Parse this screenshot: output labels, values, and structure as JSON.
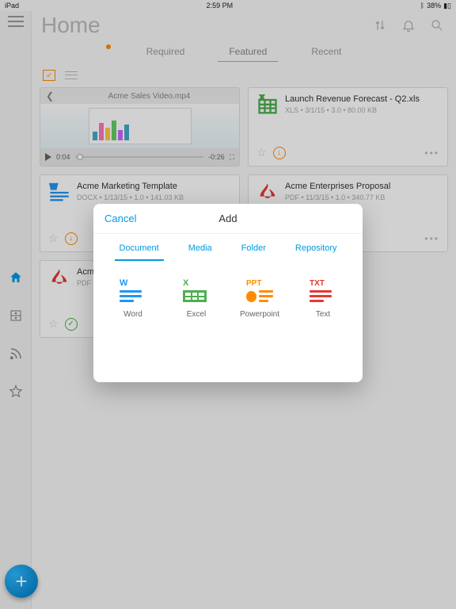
{
  "statusbar": {
    "device": "iPad",
    "time": "2:59 PM",
    "battery": "38%"
  },
  "header": {
    "title": "Home"
  },
  "tabs": {
    "required": "Required",
    "featured": "Featured",
    "recent": "Recent"
  },
  "video": {
    "title": "Acme Sales Video.mp4",
    "elapsed": "0:04",
    "remaining": "-0:26"
  },
  "cards": {
    "launch": {
      "title": "Launch Revenue Forecast - Q2.xls",
      "meta": "XLS  •  3/1/15  •  3.0  •  80.00 KB"
    },
    "marketing": {
      "title": "Acme Marketing Template",
      "meta": "DOCX  •  1/13/15  •  1.0  •  141.03 KB"
    },
    "proposal": {
      "title": "Acme Enterprises Proposal",
      "meta": "PDF  •  11/3/15  •  1.0  •  340.77 KB"
    },
    "acmepdf": {
      "title": "Acme",
      "meta": "PDF  •"
    }
  },
  "modal": {
    "cancel": "Cancel",
    "title": "Add",
    "tabs": {
      "document": "Document",
      "media": "Media",
      "folder": "Folder",
      "repository": "Repository"
    },
    "options": {
      "word": "Word",
      "excel": "Excel",
      "powerpoint": "Powerpoint",
      "text": "Text"
    }
  }
}
